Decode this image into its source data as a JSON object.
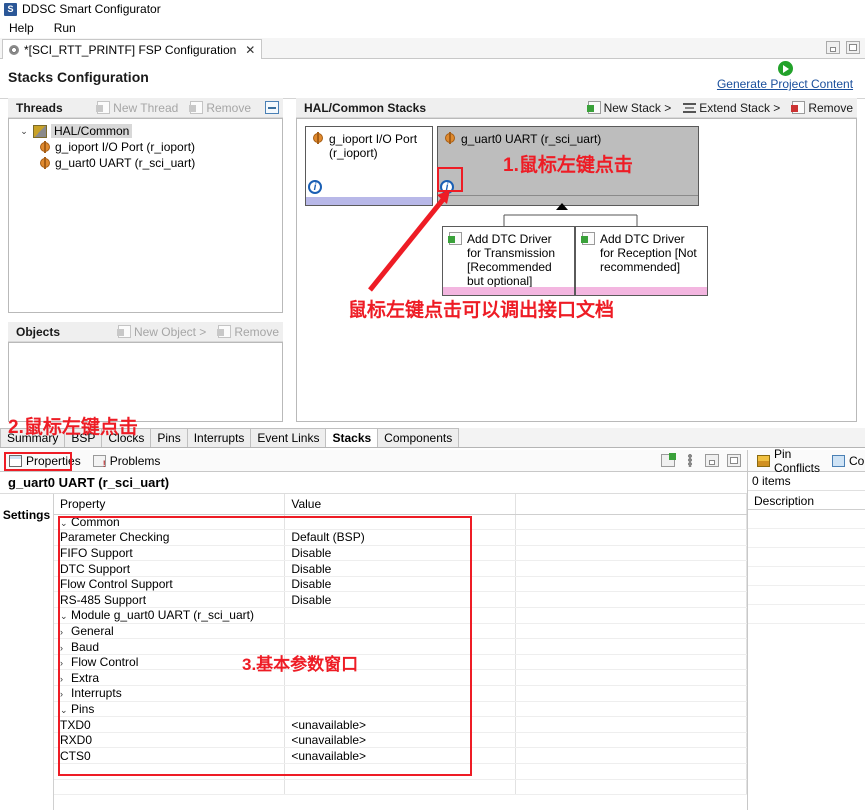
{
  "window": {
    "app_icon": "app-icon",
    "title": "DDSC Smart Configurator",
    "menus": [
      "Help",
      "Run"
    ],
    "editor_tab": "*[SCI_RTT_PRINTF] FSP Configuration",
    "editor_tab_close": "✕",
    "minimize": "minimize-icon",
    "maximize": "maximize-icon"
  },
  "page": {
    "title": "Stacks Configuration",
    "generate_link": "Generate Project Content"
  },
  "threads": {
    "header": "Threads",
    "new_thread": "New Thread",
    "remove": "Remove",
    "collapse_all": "collapse-all-icon",
    "tree": [
      {
        "label": "HAL/Common",
        "twisty": "⌄",
        "selected": true
      },
      {
        "label": "g_ioport I/O Port (r_ioport)",
        "twisty": "",
        "selected": false
      },
      {
        "label": "g_uart0 UART (r_sci_uart)",
        "twisty": "",
        "selected": false
      }
    ]
  },
  "objects": {
    "header": "Objects",
    "new_object": "New Object >",
    "remove": "Remove"
  },
  "stacks": {
    "header": "HAL/Common Stacks",
    "new_stack": "New Stack >",
    "extend_stack": "Extend Stack >",
    "remove": "Remove",
    "boxes": [
      {
        "title": "g_ioport I/O Port (r_ioport)",
        "info": "i",
        "selected": false,
        "footer_color": "#b8b8e8"
      },
      {
        "title": "g_uart0 UART (r_sci_uart)",
        "info": "i",
        "selected": true,
        "footer_color": "#bdbdbd"
      },
      {
        "title": "Add DTC Driver for Transmission [Recommended but optional]",
        "info": "",
        "selected": false,
        "footer_color": "#f3b6e0"
      },
      {
        "title": "Add DTC Driver for Reception [Not recommended]",
        "info": "",
        "selected": false,
        "footer_color": "#f3b6e0"
      }
    ]
  },
  "component_tabs": [
    {
      "label": "Summary",
      "active": false
    },
    {
      "label": "BSP",
      "active": false
    },
    {
      "label": "Clocks",
      "active": false
    },
    {
      "label": "Pins",
      "active": false
    },
    {
      "label": "Interrupts",
      "active": false
    },
    {
      "label": "Event Links",
      "active": false
    },
    {
      "label": "Stacks",
      "active": true
    },
    {
      "label": "Components",
      "active": false
    }
  ],
  "properties": {
    "tabs": [
      {
        "label": "Properties",
        "icon": "properties-icon",
        "active": true
      },
      {
        "label": "Problems",
        "icon": "problems-icon",
        "active": false
      }
    ],
    "subject": "g_uart0 UART (r_sci_uart)",
    "settings_tab": "Settings",
    "columns": [
      "Property",
      "Value"
    ],
    "rows": [
      {
        "twisty": "⌄",
        "indent": 0,
        "property": "Common",
        "value": ""
      },
      {
        "twisty": "",
        "indent": 1,
        "property": "Parameter Checking",
        "value": "Default (BSP)"
      },
      {
        "twisty": "",
        "indent": 1,
        "property": "FIFO Support",
        "value": "Disable"
      },
      {
        "twisty": "",
        "indent": 1,
        "property": "DTC Support",
        "value": "Disable"
      },
      {
        "twisty": "",
        "indent": 1,
        "property": "Flow Control Support",
        "value": "Disable"
      },
      {
        "twisty": "",
        "indent": 1,
        "property": "RS-485 Support",
        "value": "Disable"
      },
      {
        "twisty": "⌄",
        "indent": 0,
        "property": "Module g_uart0 UART (r_sci_uart)",
        "value": ""
      },
      {
        "twisty": "›",
        "indent": 2,
        "property": "General",
        "value": ""
      },
      {
        "twisty": "›",
        "indent": 2,
        "property": "Baud",
        "value": ""
      },
      {
        "twisty": "›",
        "indent": 2,
        "property": "Flow Control",
        "value": ""
      },
      {
        "twisty": "›",
        "indent": 2,
        "property": "Extra",
        "value": ""
      },
      {
        "twisty": "›",
        "indent": 2,
        "property": "Interrupts",
        "value": ""
      },
      {
        "twisty": "⌄",
        "indent": 0,
        "property": "Pins",
        "value": ""
      },
      {
        "twisty": "",
        "indent": 1,
        "property": "TXD0",
        "value": "<unavailable>"
      },
      {
        "twisty": "",
        "indent": 1,
        "property": "RXD0",
        "value": "<unavailable>"
      },
      {
        "twisty": "",
        "indent": 1,
        "property": "CTS0",
        "value": "<unavailable>"
      },
      {
        "twisty": "",
        "indent": 1,
        "property": "",
        "value": ""
      },
      {
        "twisty": "",
        "indent": 1,
        "property": "",
        "value": ""
      }
    ]
  },
  "pin_conflicts": {
    "tabs": [
      {
        "label": "Pin Conflicts",
        "active": true
      },
      {
        "label": "Co",
        "active": false
      }
    ],
    "count": "0 items",
    "column": "Description"
  },
  "annotations": [
    {
      "id": "ann-1",
      "text": "1.鼠标左键点击"
    },
    {
      "id": "ann-2",
      "text": "2.鼠标左键点击"
    },
    {
      "id": "ann-3",
      "text": "3.基本参数窗口"
    },
    {
      "id": "ann-4",
      "text": "鼠标左键点击可以调出接口文档"
    }
  ],
  "colors": {
    "annotation_red": "#ee1c25",
    "link_blue": "#1a4f9c",
    "generate_green": "#22a22a",
    "selected_gray": "#bdbdbd",
    "dtc_pink": "#f3b6e0",
    "ioport_lavender": "#b8b8e8"
  }
}
